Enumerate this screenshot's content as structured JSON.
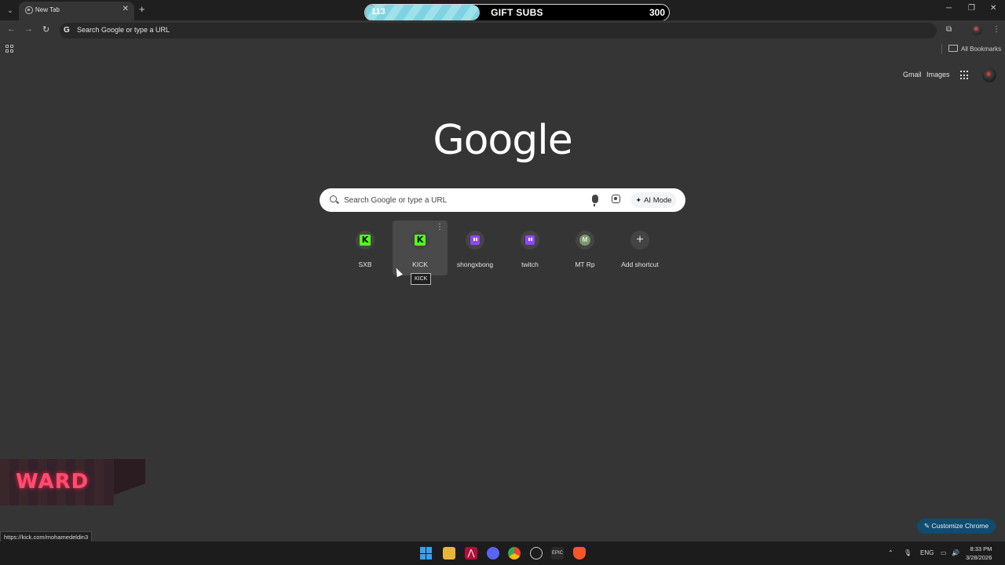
{
  "tab": {
    "title": "New Tab"
  },
  "stream_goal": {
    "current": 113,
    "goal": 300,
    "current_label": "113",
    "goal_label": "300",
    "label": "GIFT SUBS",
    "progress_fraction": 0.377
  },
  "omnibox": {
    "placeholder": "Search Google or type a URL"
  },
  "bookmarks": {
    "all_bookmarks": "All Bookmarks"
  },
  "header_links": {
    "gmail": "Gmail",
    "images": "Images"
  },
  "logo": "Google",
  "search": {
    "placeholder": "Search Google or type a URL",
    "ai_mode": "AI Mode"
  },
  "shortcuts": [
    {
      "label": "SXB",
      "icon": "kick-icon"
    },
    {
      "label": "KICK",
      "icon": "kick-icon"
    },
    {
      "label": "shongxbong",
      "icon": "twitch-icon"
    },
    {
      "label": "twitch",
      "icon": "twitch-icon"
    },
    {
      "label": "MT Rp",
      "icon": "letter-m-icon",
      "letter": "M"
    },
    {
      "label": "Add shortcut",
      "icon": "plus-icon"
    }
  ],
  "tooltip": "KICK",
  "overlay_logo_text": "WARD",
  "status_url": "https://kick.com/mohamedeldin3",
  "customize_button": "Customize Chrome",
  "taskbar": {
    "lang": "ENG",
    "time": "8:33 PM",
    "date": "3/28/2026"
  },
  "colors": {
    "accent_kick": "#53fc18",
    "accent_twitch": "#9146ff",
    "customize_bg": "#0f4c6e",
    "goal_fill": "#7fd3e0"
  }
}
